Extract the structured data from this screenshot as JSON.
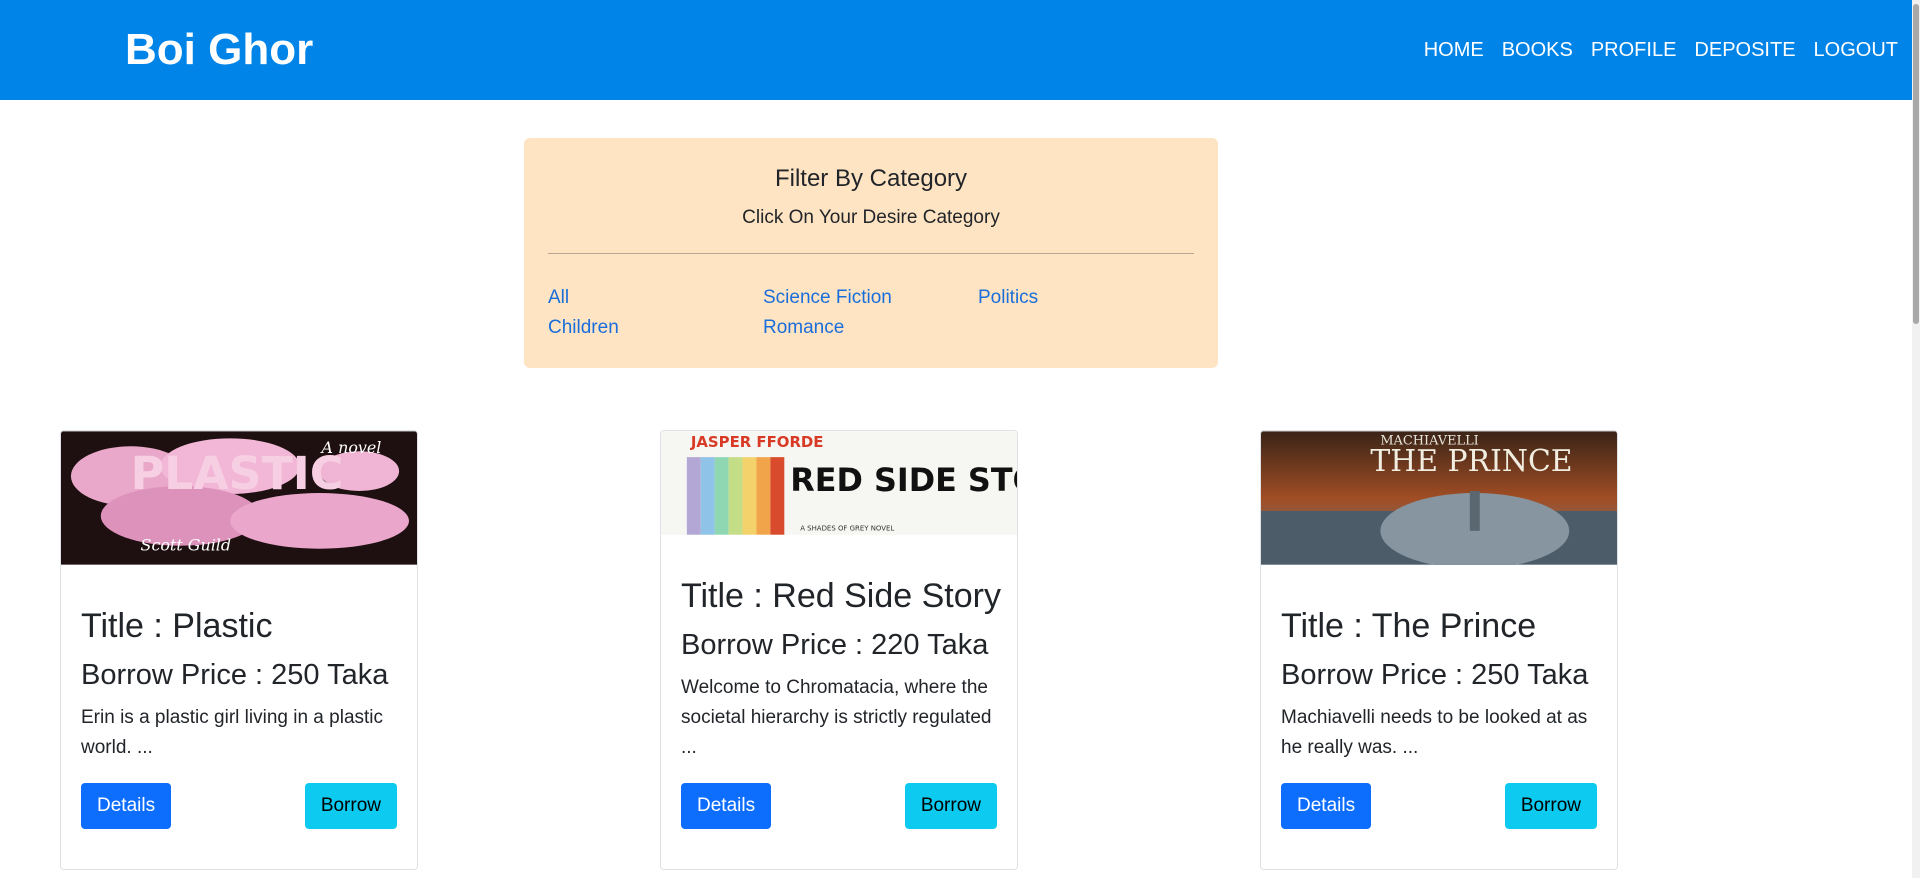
{
  "brand": "Boi Ghor",
  "nav": [
    "HOME",
    "BOOKS",
    "PROFILE",
    "DEPOSITE",
    "LOGOUT"
  ],
  "filter": {
    "title": "Filter By Category",
    "subtitle": "Click On Your Desire Category",
    "categories": [
      "All",
      "Science Fiction",
      "Politics",
      "Children",
      "Romance"
    ]
  },
  "books": [
    {
      "cover_text": "PLASTIC",
      "cover_tag": "A novel",
      "cover_author": "Scott Guild",
      "title": "Title : Plastic",
      "price": "Borrow Price : 250 Taka",
      "description": "Erin is a plastic girl living in a plastic world. ...",
      "details_label": "Details",
      "borrow_label": "Borrow"
    },
    {
      "cover_author": "JASPER FFORDE",
      "cover_text": "RED SIDE STORY",
      "cover_tag": "A SHADES OF GREY NOVEL",
      "title": "Title : Red Side Story",
      "price": "Borrow Price : 220 Taka",
      "description": "Welcome to Chromatacia, where the societal hierarchy is strictly regulated ...",
      "details_label": "Details",
      "borrow_label": "Borrow"
    },
    {
      "cover_author": "MACHIAVELLI",
      "cover_text": "THE PRINCE",
      "title": "Title : The Prince",
      "price": "Borrow Price : 250 Taka",
      "description": "Machiavelli needs to be looked at as he really was. ...",
      "details_label": "Details",
      "borrow_label": "Borrow"
    }
  ],
  "colors": {
    "navbar": "#0084e8",
    "filter_bg": "#ffe4c3",
    "link": "#1a6edb",
    "btn_primary": "#0d6efd",
    "btn_info": "#0dcaf0"
  }
}
